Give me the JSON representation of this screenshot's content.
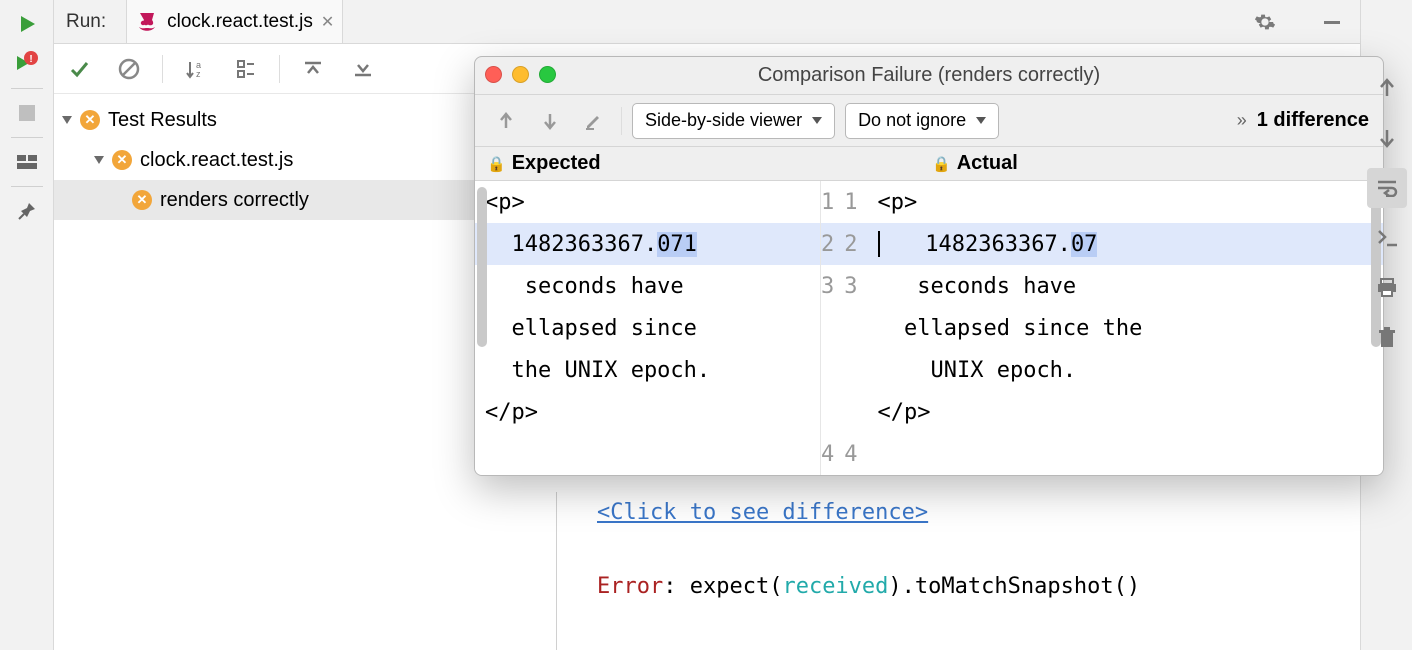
{
  "run": {
    "label": "Run:",
    "tab_file": "clock.react.test.js"
  },
  "tree": {
    "root": "Test Results",
    "suite": "clock.react.test.js",
    "test": "renders correctly"
  },
  "popup": {
    "title": "Comparison Failure (renders correctly)",
    "viewer_mode": "Side-by-side viewer",
    "ignore_mode": "Do not ignore",
    "diff_count": "1 difference",
    "expected_label": "Expected",
    "actual_label": "Actual",
    "expected_lines": [
      "<p>",
      "  1482363367.",
      "071",
      "   seconds have",
      "  ellapsed since",
      "  the UNIX epoch.",
      "</p>"
    ],
    "actual_lines": [
      "<p>",
      "   1482363367.",
      "07",
      "   seconds have ",
      "  ellapsed since the",
      "    UNIX epoch.",
      "</p>"
    ],
    "gutter_left": [
      "1",
      "2",
      "3",
      "",
      "",
      "",
      "4"
    ],
    "gutter_right": [
      "1",
      "2",
      "3",
      "",
      "",
      "",
      "4"
    ]
  },
  "console": {
    "link": "<Click to see difference>",
    "error_prefix": "Error",
    "error_rest1": ": expect(",
    "error_recv": "received",
    "error_rest2": ").toMatchSnapshot()"
  }
}
